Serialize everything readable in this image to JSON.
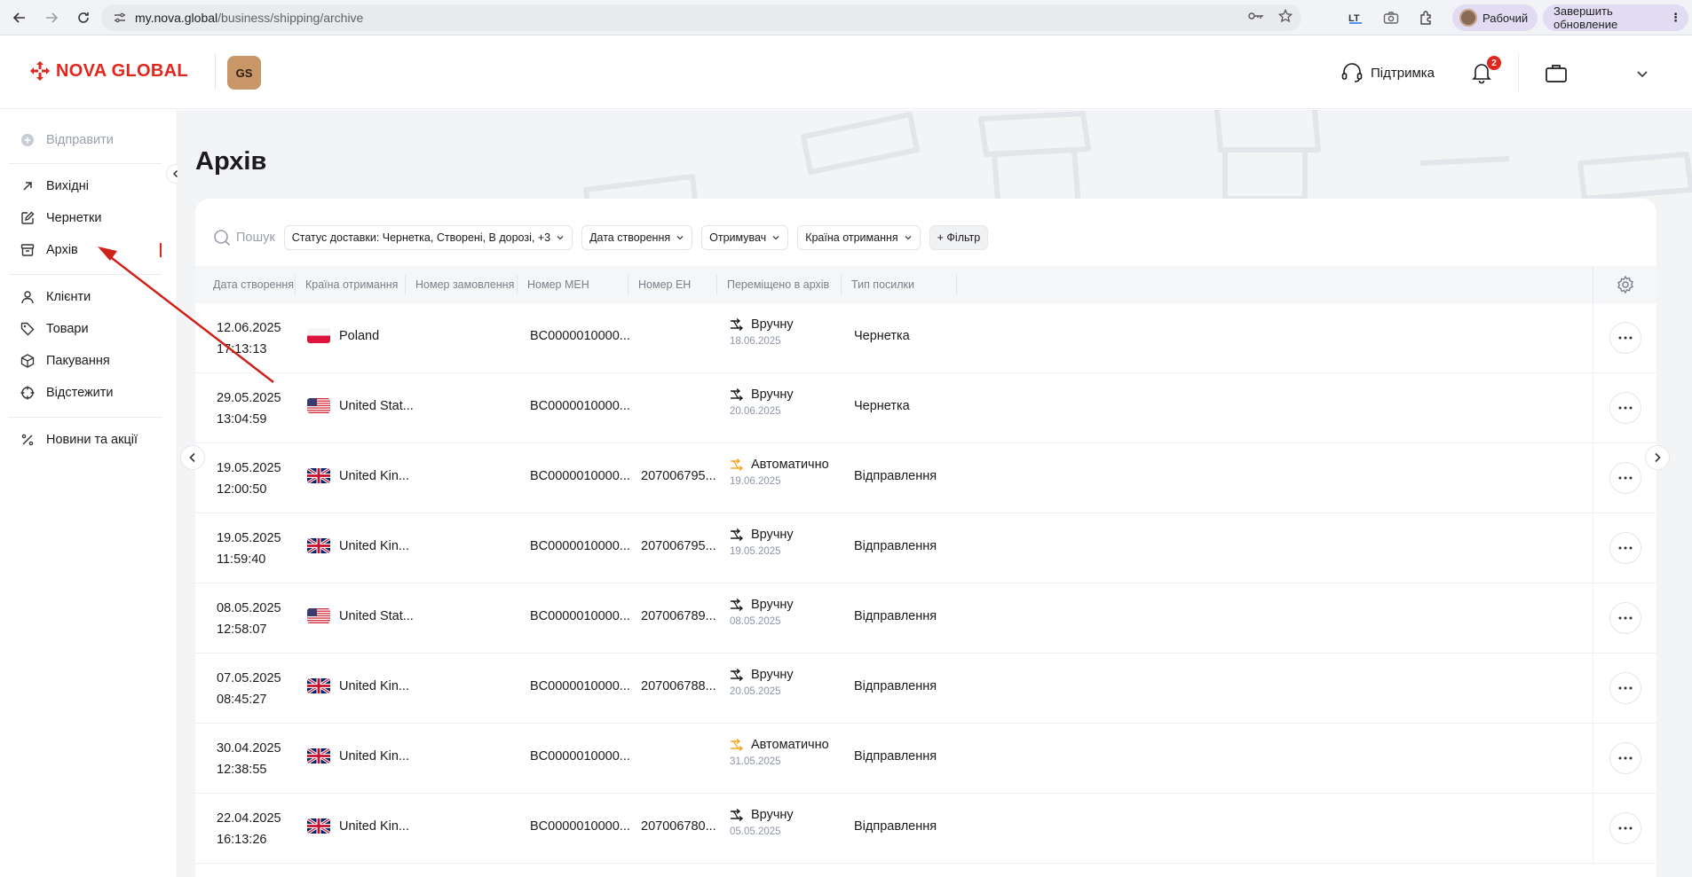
{
  "browser": {
    "url_host": "my.nova.global",
    "url_path": "/business/shipping/archive",
    "profile_label": "Рабочий",
    "update_label": "Завершить обновление",
    "toolbar_icons": [
      "translate-icon",
      "camera-icon",
      "extensions-icon"
    ]
  },
  "header": {
    "logo_text": "NOVA GLOBAL",
    "company_badge": "GS",
    "support_label": "Підтримка",
    "notifications_count": "2",
    "brand_color": "#e1261c"
  },
  "sidebar": {
    "send_label": "Відправити",
    "items": [
      {
        "label": "Вихідні",
        "icon": "arrow-up-right-icon"
      },
      {
        "label": "Чернетки",
        "icon": "edit-icon"
      },
      {
        "label": "Архів",
        "icon": "archive-icon",
        "active": true
      },
      {
        "label": "Клієнти",
        "icon": "users-icon"
      },
      {
        "label": "Товари",
        "icon": "tag-icon"
      },
      {
        "label": "Пакування",
        "icon": "box-icon"
      },
      {
        "label": "Відстежити",
        "icon": "target-icon"
      },
      {
        "label": "Новини та акції",
        "icon": "percent-icon"
      }
    ]
  },
  "page": {
    "title": "Архів"
  },
  "filters": {
    "search_placeholder": "Пошук",
    "status": "Статус доставки: Чернетка, Створені, В дорозі, +3",
    "created_date": "Дата створення",
    "recipient": "Отримувач",
    "country": "Країна отримання",
    "add_filter": "+ Фільтр"
  },
  "table": {
    "columns": [
      "Дата створення",
      "Країна отримання",
      "Номер замовлення",
      "Номер МЕН",
      "Номер ЕН",
      "Переміщено в архів",
      "Тип посилки"
    ],
    "rows": [
      {
        "date": "12.06.2025",
        "time": "17:13:13",
        "country": "Poland",
        "flag": "pl",
        "meh": "BC0000010000...",
        "en": "",
        "move": "Вручну",
        "auto": false,
        "move_date": "18.06.2025",
        "type": "Чернетка"
      },
      {
        "date": "29.05.2025",
        "time": "13:04:59",
        "country": "United Stat...",
        "flag": "us",
        "meh": "BC0000010000...",
        "en": "",
        "move": "Вручну",
        "auto": false,
        "move_date": "20.06.2025",
        "type": "Чернетка"
      },
      {
        "date": "19.05.2025",
        "time": "12:00:50",
        "country": "United Kin...",
        "flag": "uk",
        "meh": "BC0000010000...",
        "en": "207006795...",
        "move": "Автоматично",
        "auto": true,
        "move_date": "19.06.2025",
        "type": "Відправлення"
      },
      {
        "date": "19.05.2025",
        "time": "11:59:40",
        "country": "United Kin...",
        "flag": "uk",
        "meh": "BC0000010000...",
        "en": "207006795...",
        "move": "Вручну",
        "auto": false,
        "move_date": "19.05.2025",
        "type": "Відправлення"
      },
      {
        "date": "08.05.2025",
        "time": "12:58:07",
        "country": "United Stat...",
        "flag": "us",
        "meh": "BC0000010000...",
        "en": "207006789...",
        "move": "Вручну",
        "auto": false,
        "move_date": "08.05.2025",
        "type": "Відправлення"
      },
      {
        "date": "07.05.2025",
        "time": "08:45:27",
        "country": "United Kin...",
        "flag": "uk",
        "meh": "BC0000010000...",
        "en": "207006788...",
        "move": "Вручну",
        "auto": false,
        "move_date": "20.05.2025",
        "type": "Відправлення"
      },
      {
        "date": "30.04.2025",
        "time": "12:38:55",
        "country": "United Kin...",
        "flag": "uk",
        "meh": "BC0000010000...",
        "en": "",
        "move": "Автоматично",
        "auto": true,
        "move_date": "31.05.2025",
        "type": "Відправлення"
      },
      {
        "date": "22.04.2025",
        "time": "16:13:26",
        "country": "United Kin...",
        "flag": "uk",
        "meh": "BC0000010000...",
        "en": "207006780...",
        "move": "Вручну",
        "auto": false,
        "move_date": "05.05.2025",
        "type": "Відправлення"
      }
    ]
  },
  "colors": {
    "accent_red": "#e1261c",
    "auto_orange": "#f5a623",
    "muted_text": "#8e96a8"
  }
}
